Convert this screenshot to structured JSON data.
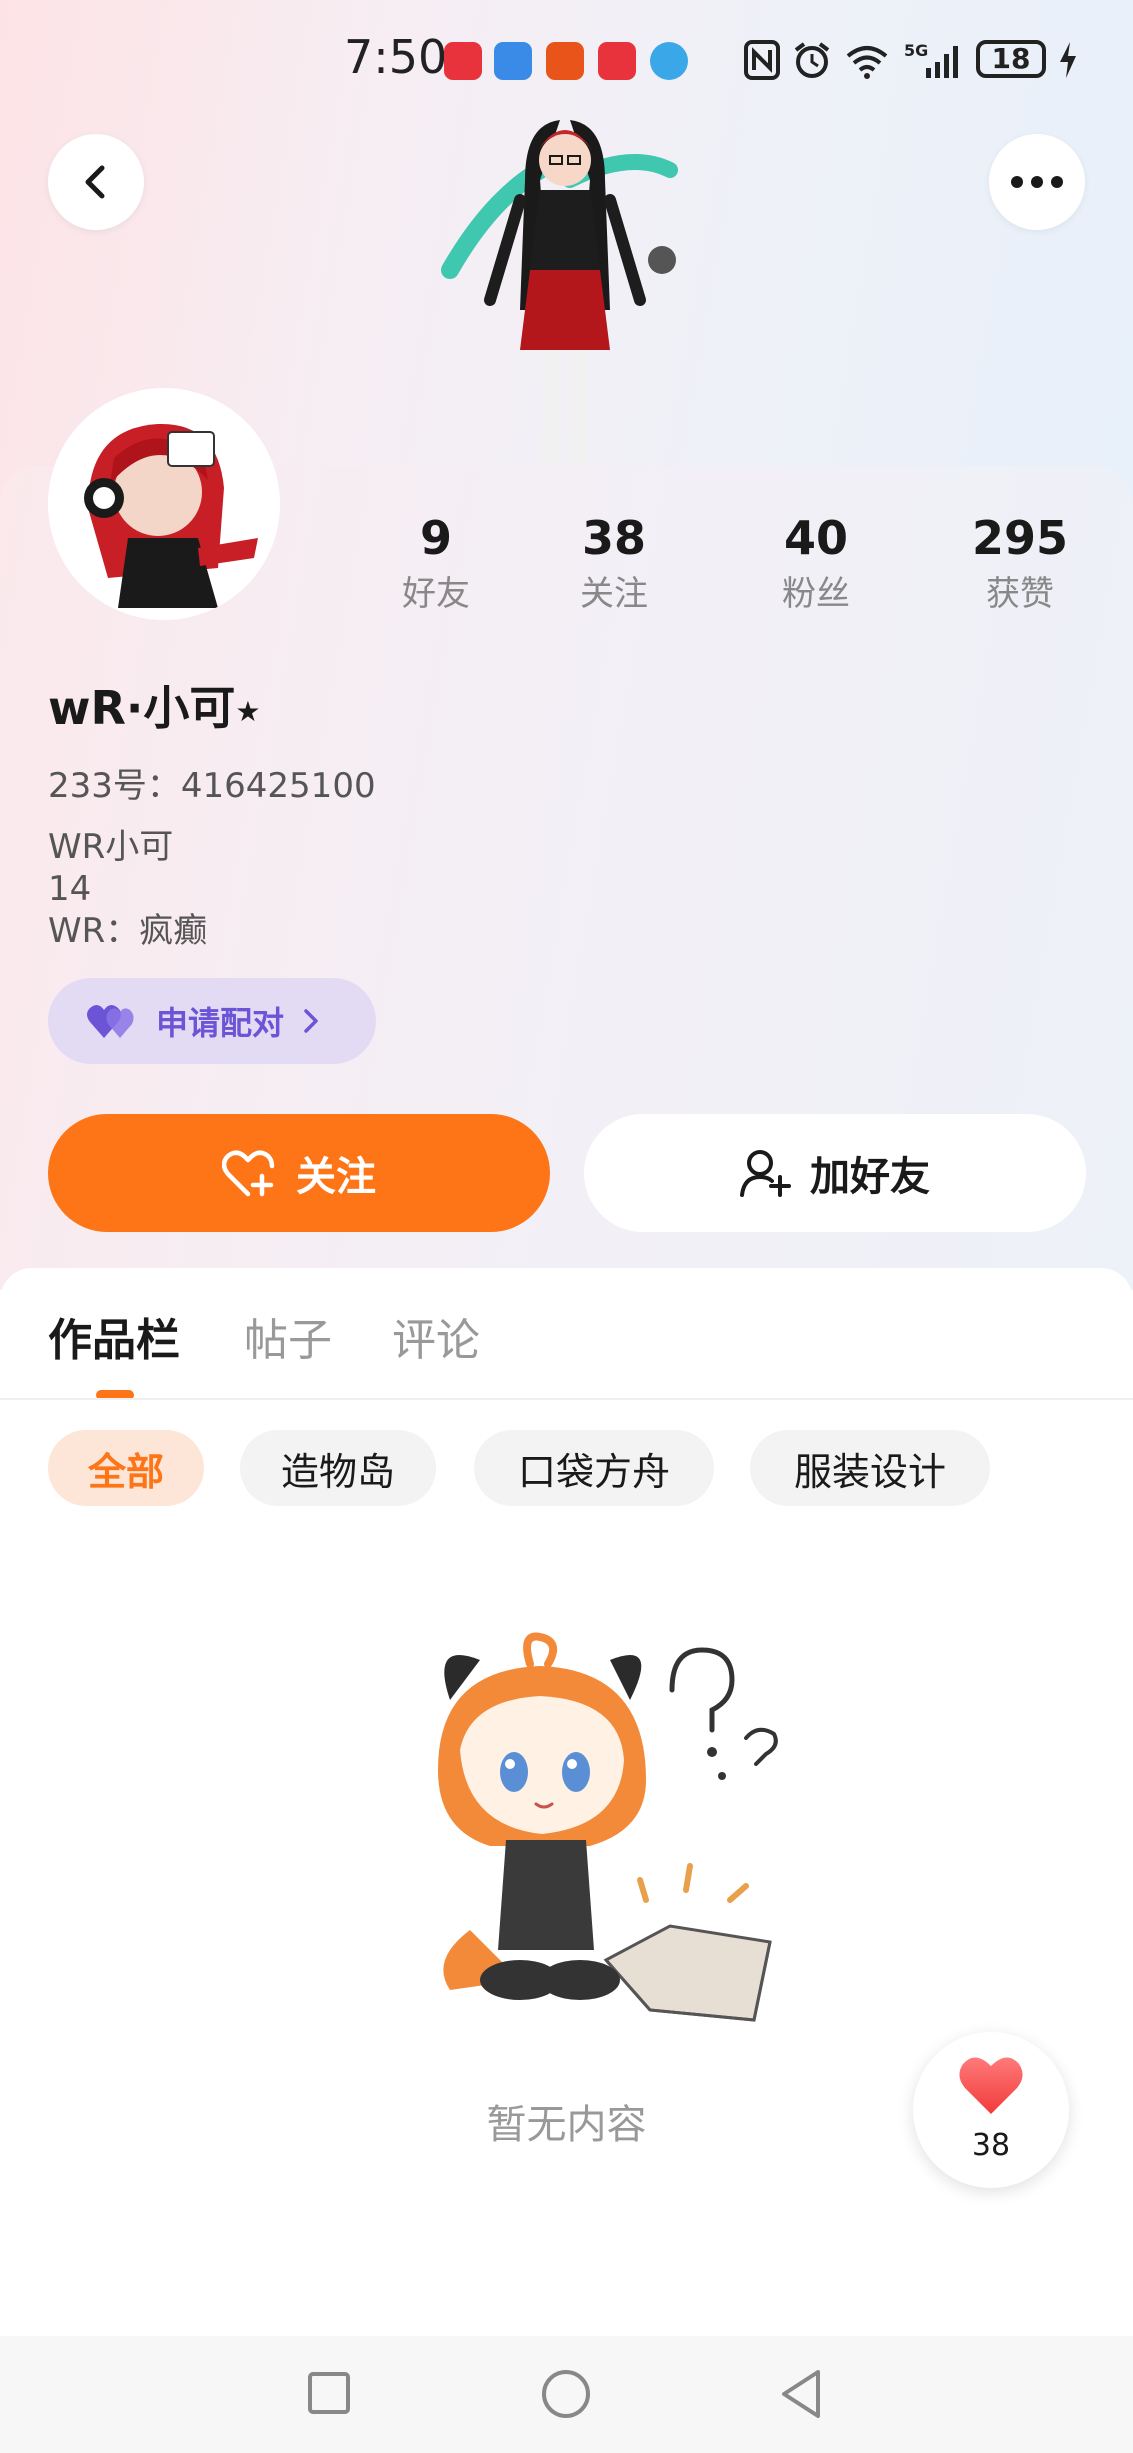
{
  "status_bar": {
    "time": "7:50",
    "battery": "18",
    "app_badges": [
      "小红书",
      "app-icon",
      "淘宝",
      "华为",
      "browser-icon"
    ],
    "icons": [
      "nfc-icon",
      "alarm-icon",
      "wifi-icon",
      "signal-5g-icon",
      "charging-icon"
    ]
  },
  "header": {
    "back_icon": "chevron-left-icon",
    "more_icon": "more-dots-icon"
  },
  "profile": {
    "nickname": "wR·小可",
    "nickname_suffix": "★",
    "uid": "233号：416425100",
    "bio_lines": [
      "WR小可",
      "14",
      "WR：疯癫"
    ]
  },
  "stats": [
    {
      "value": "9",
      "label": "好友"
    },
    {
      "value": "38",
      "label": "关注"
    },
    {
      "value": "40",
      "label": "粉丝"
    },
    {
      "value": "295",
      "label": "获赞"
    }
  ],
  "pair_button": {
    "label": "申请配对",
    "icon": "heart-pair-icon"
  },
  "actions": {
    "follow_label": "关注",
    "add_friend_label": "加好友"
  },
  "tabs": [
    {
      "label": "作品栏",
      "active": true
    },
    {
      "label": "帖子",
      "active": false
    },
    {
      "label": "评论",
      "active": false
    }
  ],
  "filters": [
    {
      "label": "全部",
      "active": true
    },
    {
      "label": "造物岛",
      "active": false
    },
    {
      "label": "口袋方舟",
      "active": false
    },
    {
      "label": "服装设计",
      "active": false
    }
  ],
  "empty_state": {
    "text": "暂无内容"
  },
  "like_float": {
    "count": "38"
  },
  "colors": {
    "accent": "#fd7516",
    "pair_bg": "#e3dbf4",
    "pair_text": "#6b55d6",
    "chip_active_bg": "#fde6d8"
  }
}
